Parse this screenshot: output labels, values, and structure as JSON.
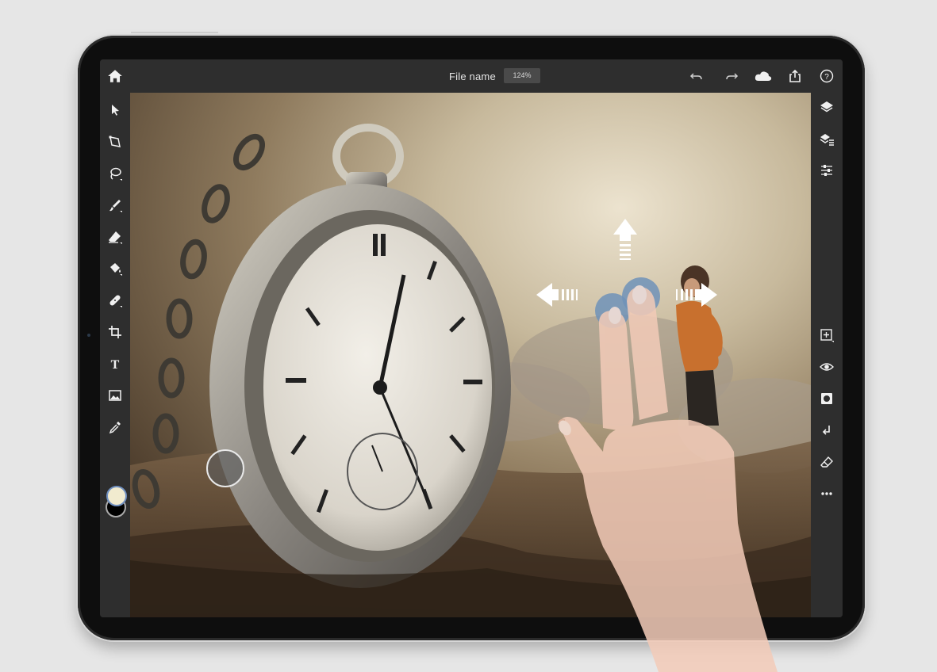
{
  "app": {
    "file_name": "File name",
    "zoom_level": "124%"
  },
  "toolbar_top": {
    "icons": [
      "home-icon",
      "undo-icon",
      "redo-icon",
      "cloud-icon",
      "share-icon",
      "help-icon"
    ]
  },
  "toolbar_left": {
    "tools": [
      "select-icon",
      "transform-icon",
      "lasso-icon",
      "brush-icon",
      "eraser-icon",
      "fill-icon",
      "healing-icon",
      "crop-icon",
      "text-icon",
      "image-icon",
      "eyedropper-icon"
    ],
    "foreground_color": "#f1ebcf",
    "background_color": "#000000"
  },
  "toolbar_right": {
    "panels": [
      "layers-icon",
      "layer-properties-icon",
      "adjustments-icon",
      "add-layer-icon",
      "visibility-icon",
      "mask-icon",
      "clip-icon",
      "erase-layer-icon",
      "more-icon"
    ]
  },
  "gesture": {
    "type": "two-finger-pan",
    "directions": [
      "up",
      "left",
      "right"
    ],
    "touch_color": "#6f92b8"
  }
}
